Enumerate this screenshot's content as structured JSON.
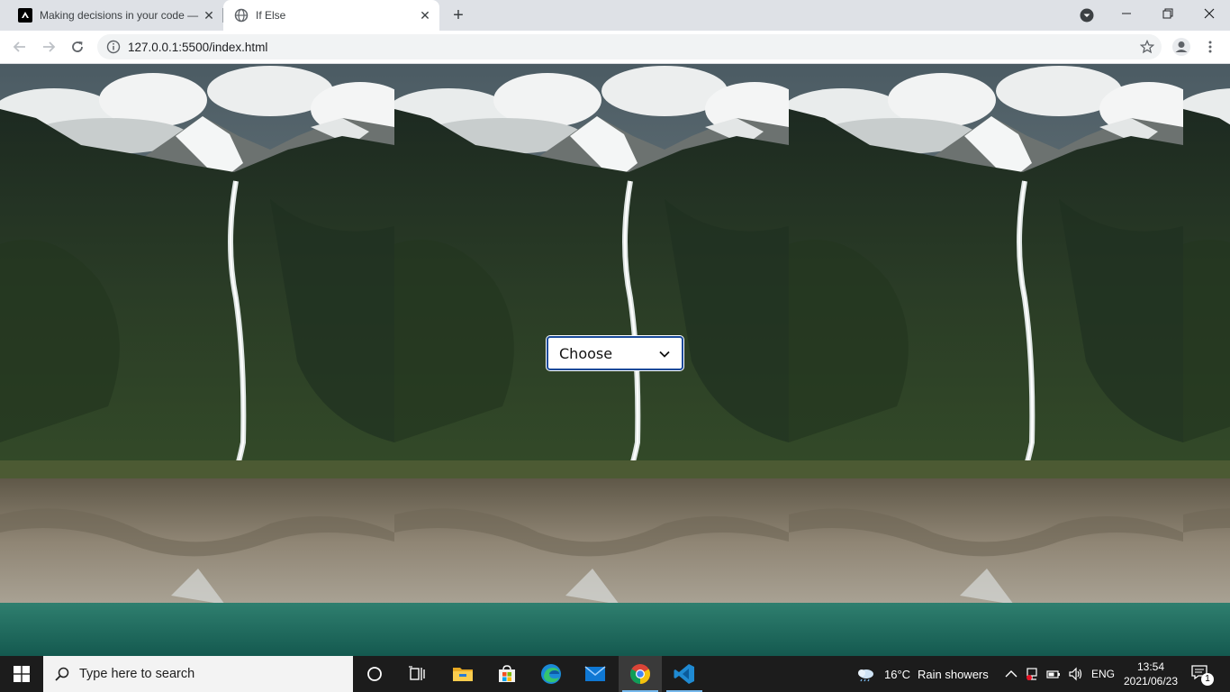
{
  "browser": {
    "tabs": [
      {
        "title": "Making decisions in your code —",
        "favicon": "mdn-logo-icon",
        "active": false
      },
      {
        "title": "If Else",
        "favicon": "globe-icon",
        "active": true
      }
    ],
    "address": "127.0.0.1:5500/index.html"
  },
  "page": {
    "select": {
      "selected": "Choose"
    },
    "background": "mountain-waterfall-lake-photo"
  },
  "taskbar": {
    "search_placeholder": "Type here to search",
    "weather": {
      "temp": "16°C",
      "condition": "Rain showers"
    },
    "language": "ENG",
    "time": "13:54",
    "date": "2021/06/23",
    "notification_count": "1",
    "apps": [
      "cortana-icon",
      "task-view-icon",
      "file-explorer-icon",
      "microsoft-store-icon",
      "edge-icon",
      "mail-icon",
      "chrome-icon",
      "vscode-icon"
    ]
  },
  "colors": {
    "accent": "#1a4a9a",
    "taskbar": "#1c1c1c",
    "tabstrip": "#dee1e6"
  }
}
